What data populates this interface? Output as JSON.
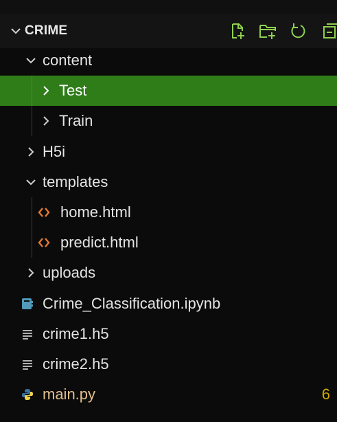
{
  "explorer": {
    "title": "CRIME",
    "actions": {
      "new_file": "new-file-icon",
      "new_folder": "new-folder-icon",
      "refresh": "refresh-icon",
      "collapse": "collapse-all-icon"
    }
  },
  "tree": {
    "content": "content",
    "test": "Test",
    "train": "Train",
    "h5i": "H5i",
    "templates": "templates",
    "home_html": "home.html",
    "predict_html": "predict.html",
    "uploads": "uploads",
    "notebook": "Crime_Classification.ipynb",
    "crime1": "crime1.h5",
    "crime2": "crime2.h5",
    "main_py": "main.py",
    "main_py_badge": "6"
  },
  "colors": {
    "selected_row": "#2f7d19",
    "action_icons": "#8fd14f",
    "html_icon": "#e37933",
    "python_file": "#e2c08d",
    "badge": "#cca700"
  }
}
